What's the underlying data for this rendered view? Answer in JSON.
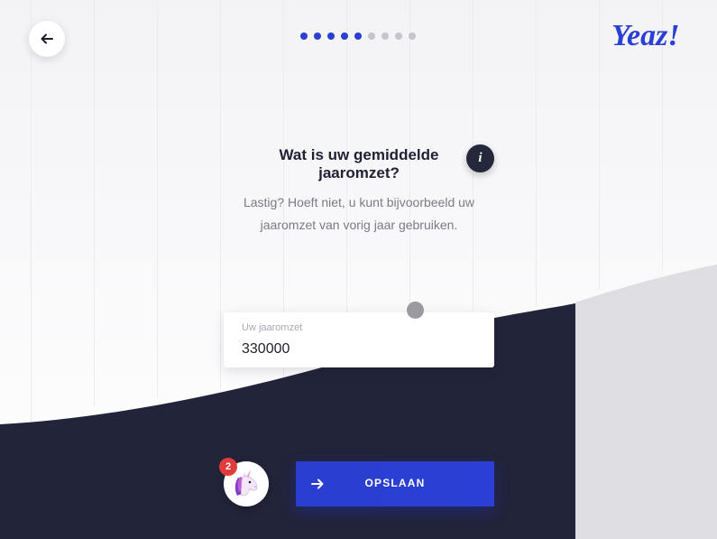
{
  "header": {
    "logo_text": "Yeaz!",
    "progress": {
      "total": 9,
      "completed": 5
    }
  },
  "question": {
    "title": "Wat is uw gemiddelde jaaromzet?",
    "subtitle_line1": "Lastig? Hoeft niet, u kunt bijvoorbeeld uw",
    "subtitle_line2": "jaaromzet van vorig jaar gebruiken.",
    "info_label": "i"
  },
  "revenue_input": {
    "label": "Uw jaaromzet",
    "value": "330000"
  },
  "footer": {
    "notification_count": "2",
    "save_label": "OPSLAAN"
  },
  "colors": {
    "accent": "#2b3fd4",
    "dark": "#22243a",
    "dot_active": "#2b3fd4",
    "dot_inactive": "#c5c6cd",
    "badge": "#e23b3b"
  },
  "icons": {
    "back": "arrow-left-icon",
    "info": "info-icon",
    "save": "arrow-right-icon",
    "mascot": "unicorn-icon"
  }
}
